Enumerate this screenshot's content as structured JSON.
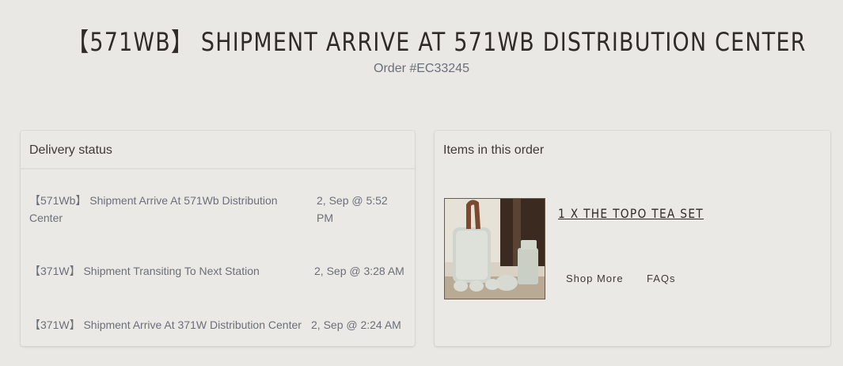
{
  "header": {
    "title": "【571WB】 SHIPMENT ARRIVE AT 571WB DISTRIBUTION CENTER",
    "order_number": "Order #EC33245"
  },
  "delivery": {
    "heading": "Delivery status",
    "events": [
      {
        "description": "【571Wb】 Shipment Arrive At 571Wb Distribution Center",
        "date": "2, Sep @ 5:52 PM"
      },
      {
        "description": "【371W】 Shipment Transiting To Next Station",
        "date": "2, Sep @ 3:28 AM"
      },
      {
        "description": "【371W】 Shipment Arrive At 371W Distribution Center",
        "date": "2, Sep @ 2:24 AM"
      }
    ]
  },
  "items": {
    "heading": "Items in this order",
    "products": [
      {
        "title": "1 X THE TOPO TEA SET",
        "image_icon": "tea-set-photo"
      }
    ],
    "links": {
      "shop_more": "Shop More",
      "faqs": "FAQs"
    }
  },
  "colors": {
    "background": "#eae8e4",
    "text_dark": "#2f2b28",
    "text_muted": "#6b6f7a"
  }
}
